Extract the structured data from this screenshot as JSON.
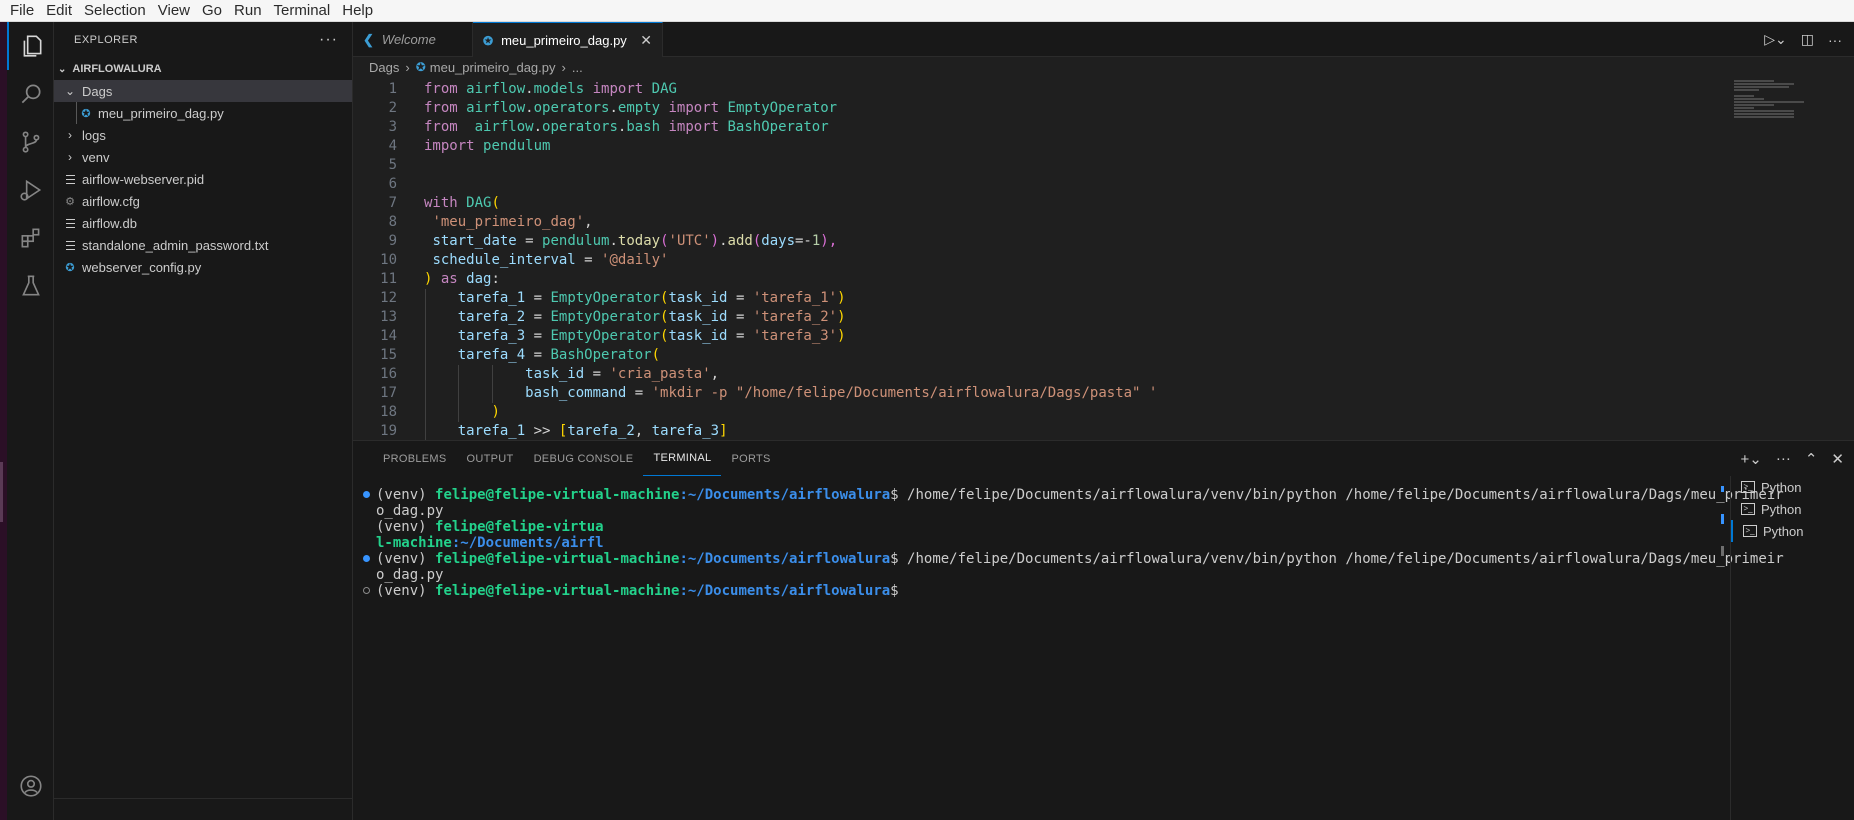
{
  "menubar": [
    "File",
    "Edit",
    "Selection",
    "View",
    "Go",
    "Run",
    "Terminal",
    "Help"
  ],
  "activity_bar": [
    "explorer-icon",
    "search-icon",
    "source-control-icon",
    "run-debug-icon",
    "extensions-icon",
    "testing-icon",
    "account-icon"
  ],
  "sidebar": {
    "title": "EXPLORER",
    "more": "···",
    "folder": "AIRFLOWALURA",
    "items": [
      {
        "label": "Dags",
        "type": "folder-open"
      },
      {
        "label": "meu_primeiro_dag.py",
        "type": "python"
      },
      {
        "label": "logs",
        "type": "folder"
      },
      {
        "label": "venv",
        "type": "folder"
      },
      {
        "label": "airflow-webserver.pid",
        "type": "text"
      },
      {
        "label": "airflow.cfg",
        "type": "config"
      },
      {
        "label": "airflow.db",
        "type": "text"
      },
      {
        "label": "standalone_admin_password.txt",
        "type": "text"
      },
      {
        "label": "webserver_config.py",
        "type": "python"
      }
    ]
  },
  "editor": {
    "tabs": [
      {
        "label": "Welcome",
        "active": false
      },
      {
        "label": "meu_primeiro_dag.py",
        "active": true
      }
    ],
    "breadcrumb": {
      "folder": "Dags",
      "file": "meu_primeiro_dag.py",
      "rest": "..."
    },
    "line_numbers": [
      "1",
      "2",
      "3",
      "4",
      "5",
      "6",
      "7",
      "8",
      "9",
      "10",
      "11",
      "12",
      "13",
      "14",
      "15",
      "16",
      "17",
      "18",
      "19"
    ],
    "code": {
      "l1": [
        "from",
        "airflow",
        ".",
        "models",
        "import",
        "DAG"
      ],
      "l2": [
        "from",
        "airflow",
        ".",
        "operators",
        ".",
        "empty",
        "import",
        "EmptyOperator"
      ],
      "l3": [
        "from",
        "airflow",
        ".",
        "operators",
        ".",
        "bash",
        "import",
        "BashOperator"
      ],
      "l4": [
        "import",
        "pendulum"
      ],
      "l7": [
        "with",
        "DAG",
        "("
      ],
      "l8": [
        "'meu_primeiro_dag'",
        ","
      ],
      "l9": [
        "start_date",
        "=",
        "pendulum",
        ".",
        "today",
        "(",
        "'UTC'",
        ")",
        ".",
        "add",
        "(",
        "days",
        "=-",
        "1",
        "),"
      ],
      "l10": [
        "schedule_interval",
        "=",
        "'@daily'"
      ],
      "l11": [
        ")",
        "as",
        "dag",
        ":"
      ],
      "l12": [
        "tarefa_1",
        "=",
        "EmptyOperator",
        "(",
        "task_id",
        "=",
        "'tarefa_1'",
        ")"
      ],
      "l13": [
        "tarefa_2",
        "=",
        "EmptyOperator",
        "(",
        "task_id",
        "=",
        "'tarefa_2'",
        ")"
      ],
      "l14": [
        "tarefa_3",
        "=",
        "EmptyOperator",
        "(",
        "task_id",
        "=",
        "'tarefa_3'",
        ")"
      ],
      "l15": [
        "tarefa_4",
        "=",
        "BashOperator",
        "("
      ],
      "l16": [
        "task_id",
        "=",
        "'cria_pasta'",
        ","
      ],
      "l17": [
        "bash_command",
        "=",
        "'mkdir -p \"/home/felipe/Documents/airflowalura/Dags/pasta\" '"
      ],
      "l18": [
        ")"
      ],
      "l19": [
        "tarefa_1",
        ">>",
        "[",
        "tarefa_2",
        ",",
        "tarefa_3",
        "]"
      ]
    }
  },
  "panel": {
    "tabs": [
      "PROBLEMS",
      "OUTPUT",
      "DEBUG CONSOLE",
      "TERMINAL",
      "PORTS"
    ],
    "active_tab": "TERMINAL",
    "terminal": {
      "venv": "(venv)",
      "user_host": "felipe@felipe-virtual-machine",
      "path": ":~/Documents/airflowalura",
      "prompt": "$",
      "cmd": " /home/felipe/Documents/airflowalura/venv/bin/python /home/felipe/Documents/airflowalura/Dags/meu_primeir",
      "cmd_wrap": "o_dag.py",
      "short_user": "felipe@felipe-virtua",
      "short_user2": "l-machine",
      "short_path": ":~/Documents/airfl"
    },
    "terminals": [
      "Python",
      "Python",
      "Python"
    ]
  },
  "colors": {
    "accent": "#0078d4",
    "background": "#1f1f1f",
    "sidebar": "#181818"
  }
}
